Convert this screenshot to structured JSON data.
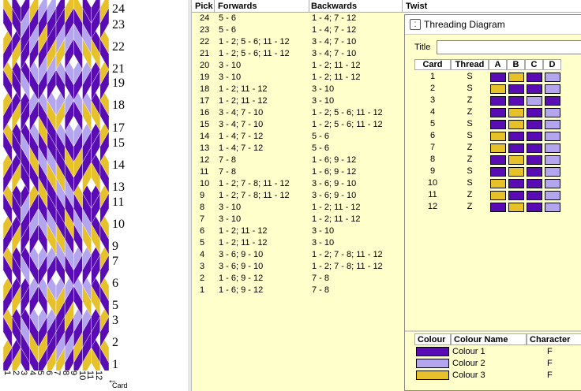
{
  "colors": {
    "colour1": "#5a0cb4",
    "colour2": "#b3a6ef",
    "colour3": "#e6c12a"
  },
  "pattern": {
    "pick_labels": [
      "24",
      "23",
      "22",
      "21",
      "19",
      "18",
      "17",
      "15",
      "14",
      "13",
      "11",
      "10",
      "9",
      "7",
      "6",
      "5",
      "3",
      "2",
      "1"
    ],
    "card_labels": [
      "1",
      "2",
      "3",
      "4",
      "5",
      "6",
      "7",
      "8",
      "9",
      "10",
      "11",
      "12"
    ],
    "card_axis_label": "Card"
  },
  "pick_table": {
    "headers": {
      "pick": "Pick",
      "forwards": "Forwards",
      "backwards": "Backwards",
      "twist": "Twist"
    },
    "rows": [
      {
        "pick": "24",
        "forwards": "5 - 6",
        "backwards": "1 - 4; 7 - 12"
      },
      {
        "pick": "23",
        "forwards": "5 - 6",
        "backwards": "1 - 4; 7 - 12"
      },
      {
        "pick": "22",
        "forwards": "1 - 2; 5 - 6; 11 - 12",
        "backwards": "3 - 4; 7 - 10"
      },
      {
        "pick": "21",
        "forwards": "1 - 2; 5 - 6; 11 - 12",
        "backwards": "3 - 4; 7 - 10"
      },
      {
        "pick": "20",
        "forwards": "3 - 10",
        "backwards": "1 - 2; 11 - 12"
      },
      {
        "pick": "19",
        "forwards": "3 - 10",
        "backwards": "1 - 2; 11 - 12"
      },
      {
        "pick": "18",
        "forwards": "1 - 2; 11 - 12",
        "backwards": "3 - 10"
      },
      {
        "pick": "17",
        "forwards": "1 - 2; 11 - 12",
        "backwards": "3 - 10"
      },
      {
        "pick": "16",
        "forwards": "3 - 4; 7 - 10",
        "backwards": "1 - 2; 5 - 6; 11 - 12"
      },
      {
        "pick": "15",
        "forwards": "3 - 4; 7 - 10",
        "backwards": "1 - 2; 5 - 6; 11 - 12"
      },
      {
        "pick": "14",
        "forwards": "1 - 4; 7 - 12",
        "backwards": "5 - 6"
      },
      {
        "pick": "13",
        "forwards": "1 - 4; 7 - 12",
        "backwards": "5 - 6"
      },
      {
        "pick": "12",
        "forwards": "7 - 8",
        "backwards": "1 - 6; 9 - 12"
      },
      {
        "pick": "11",
        "forwards": "7 - 8",
        "backwards": "1 - 6; 9 - 12"
      },
      {
        "pick": "10",
        "forwards": "1 - 2; 7 - 8; 11 - 12",
        "backwards": "3 - 6; 9 - 10"
      },
      {
        "pick": "9",
        "forwards": "1 - 2; 7 - 8; 11 - 12",
        "backwards": "3 - 6; 9 - 10"
      },
      {
        "pick": "8",
        "forwards": "3 - 10",
        "backwards": "1 - 2; 11 - 12"
      },
      {
        "pick": "7",
        "forwards": "3 - 10",
        "backwards": "1 - 2; 11 - 12"
      },
      {
        "pick": "6",
        "forwards": "1 - 2; 11 - 12",
        "backwards": "3 - 10"
      },
      {
        "pick": "5",
        "forwards": "1 - 2; 11 - 12",
        "backwards": "3 - 10"
      },
      {
        "pick": "4",
        "forwards": "3 - 6; 9 - 10",
        "backwards": "1 - 2; 7 - 8; 11 - 12"
      },
      {
        "pick": "3",
        "forwards": "3 - 6; 9 - 10",
        "backwards": "1 - 2; 7 - 8; 11 - 12"
      },
      {
        "pick": "2",
        "forwards": "1 - 6; 9 - 12",
        "backwards": "7 - 8"
      },
      {
        "pick": "1",
        "forwards": "1 - 6; 9 - 12",
        "backwards": "7 - 8"
      }
    ]
  },
  "threading": {
    "window_title": "Threading Diagram",
    "title_label": "Title",
    "title_value": "",
    "headers": {
      "card": "Card",
      "thread": "Thread",
      "a": "A",
      "b": "B",
      "c": "C",
      "d": "D"
    },
    "rows": [
      {
        "card": "1",
        "thread": "S",
        "holes": [
          1,
          3,
          1,
          2
        ]
      },
      {
        "card": "2",
        "thread": "S",
        "holes": [
          3,
          1,
          1,
          2
        ]
      },
      {
        "card": "3",
        "thread": "Z",
        "holes": [
          1,
          1,
          2,
          1
        ]
      },
      {
        "card": "4",
        "thread": "Z",
        "holes": [
          1,
          3,
          1,
          2
        ]
      },
      {
        "card": "5",
        "thread": "S",
        "holes": [
          1,
          3,
          1,
          2
        ]
      },
      {
        "card": "6",
        "thread": "S",
        "holes": [
          3,
          1,
          1,
          2
        ]
      },
      {
        "card": "7",
        "thread": "Z",
        "holes": [
          3,
          1,
          1,
          2
        ]
      },
      {
        "card": "8",
        "thread": "Z",
        "holes": [
          1,
          3,
          1,
          2
        ]
      },
      {
        "card": "9",
        "thread": "S",
        "holes": [
          1,
          3,
          1,
          2
        ]
      },
      {
        "card": "10",
        "thread": "S",
        "holes": [
          3,
          1,
          1,
          2
        ]
      },
      {
        "card": "11",
        "thread": "Z",
        "holes": [
          3,
          1,
          1,
          2
        ]
      },
      {
        "card": "12",
        "thread": "Z",
        "holes": [
          1,
          3,
          1,
          2
        ]
      }
    ]
  },
  "colour_table": {
    "headers": {
      "colour": "Colour",
      "name": "Colour Name",
      "character": "Character"
    },
    "rows": [
      {
        "name": "Colour 1",
        "character": "F",
        "color": "#5a0cb4"
      },
      {
        "name": "Colour 2",
        "character": "F",
        "color": "#b3a6ef"
      },
      {
        "name": "Colour 3",
        "character": "F",
        "color": "#e6c12a"
      }
    ]
  }
}
